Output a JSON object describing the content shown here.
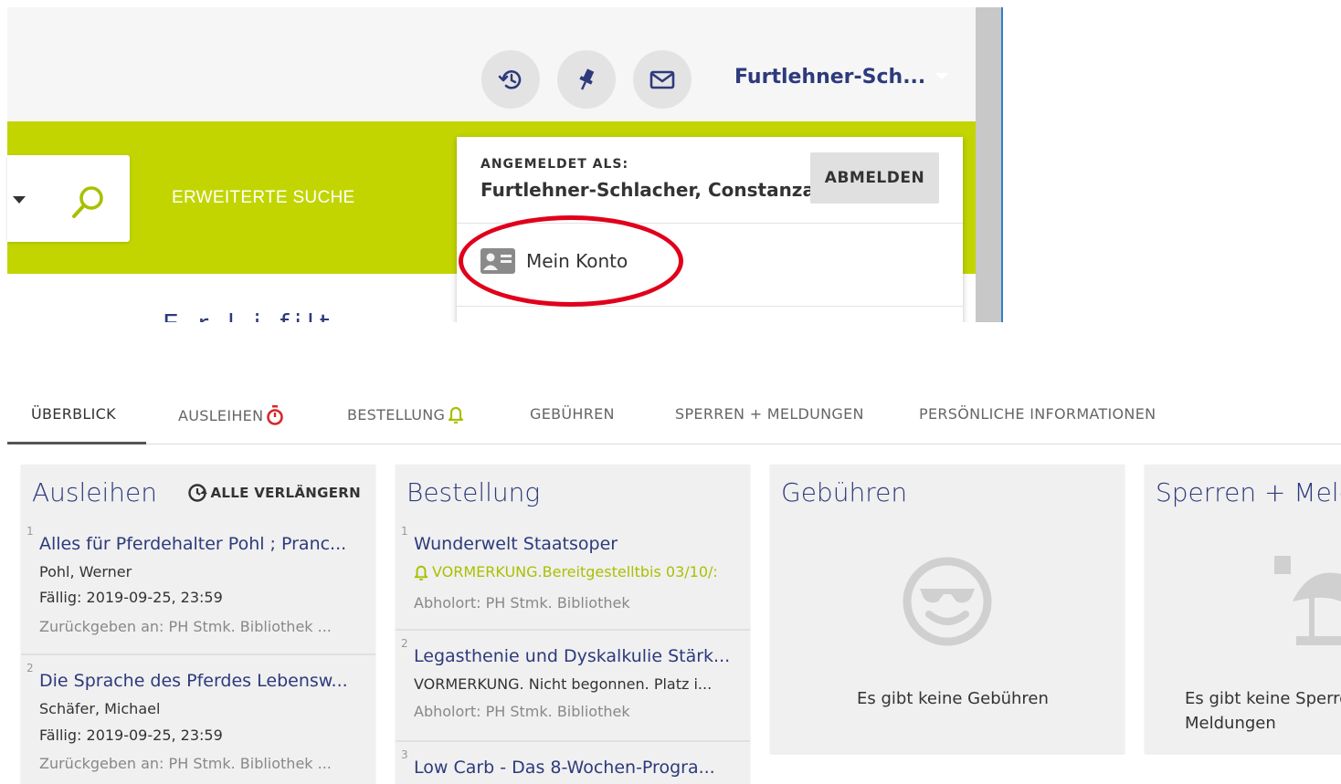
{
  "header": {
    "user_short": "Furtlehner-Sch..."
  },
  "search": {
    "advanced_label": "ERWEITERTE SUCHE",
    "partial_text": "E  r  l  i  filt"
  },
  "user_menu": {
    "logged_in_label": "ANGEMELDET ALS:",
    "full_name": "Furtlehner-Schlacher, Constanza",
    "logout_label": "ABMELDEN",
    "my_account_label": "Mein Konto"
  },
  "tabs": [
    {
      "label": "ÜBERBLICK"
    },
    {
      "label": "AUSLEIHEN"
    },
    {
      "label": "BESTELLUNG"
    },
    {
      "label": "GEBÜHREN"
    },
    {
      "label": "SPERREN + MELDUNGEN"
    },
    {
      "label": "PERSÖNLICHE INFORMATIONEN"
    }
  ],
  "loans": {
    "title": "Ausleihen",
    "renew_all_label": "ALLE VERLÄNGERN",
    "items": [
      {
        "num": "1",
        "title": "Alles für Pferdehalter Pohl ; Pranc...",
        "author": "Pohl, Werner",
        "due": "Fällig: 2019-09-25, 23:59",
        "return_label": "Zurückgeben an:",
        "return_place": "PH Stmk. Bibliothek ..."
      },
      {
        "num": "2",
        "title": "Die Sprache des Pferdes Lebensw...",
        "author": "Schäfer, Michael",
        "due": "Fällig: 2019-09-25, 23:59",
        "return_label": "Zurückgeben an:",
        "return_place": "PH Stmk. Bibliothek ..."
      }
    ]
  },
  "requests": {
    "title": "Bestellung",
    "items": [
      {
        "num": "1",
        "title": "Wunderwelt Staatsoper",
        "status": "VORMERKUNG.Bereitgestelltbis 03/10/:",
        "pickup": "Abholort: PH Stmk. Bibliothek"
      },
      {
        "num": "2",
        "title": "Legasthenie und Dyskalkulie Stärk...",
        "status": "VORMERKUNG. Nicht begonnen. Platz i...",
        "pickup": "Abholort: PH Stmk. Bibliothek"
      },
      {
        "num": "3",
        "title": "Low Carb - Das 8-Wochen-Progra..."
      }
    ]
  },
  "fees": {
    "title": "Gebühren",
    "empty_message": "Es gibt keine Gebühren"
  },
  "blocks": {
    "title": "Sperren + Meldungen",
    "empty_message_line1": "Es gibt keine Sperren",
    "empty_message_line2": "Meldungen"
  },
  "colors": {
    "accent_green": "#c2d500",
    "title_navy": "#2d3a7c",
    "annotation_red": "#e0001b",
    "alert_red": "#d62828",
    "bell_green": "#a9c000"
  },
  "icons": [
    "history-icon",
    "pin-icon",
    "mail-icon",
    "search-icon",
    "id-card-icon",
    "timer-icon",
    "bell-icon",
    "renew-clock-icon",
    "sunglasses-face-icon",
    "beach-umbrella-icon"
  ]
}
